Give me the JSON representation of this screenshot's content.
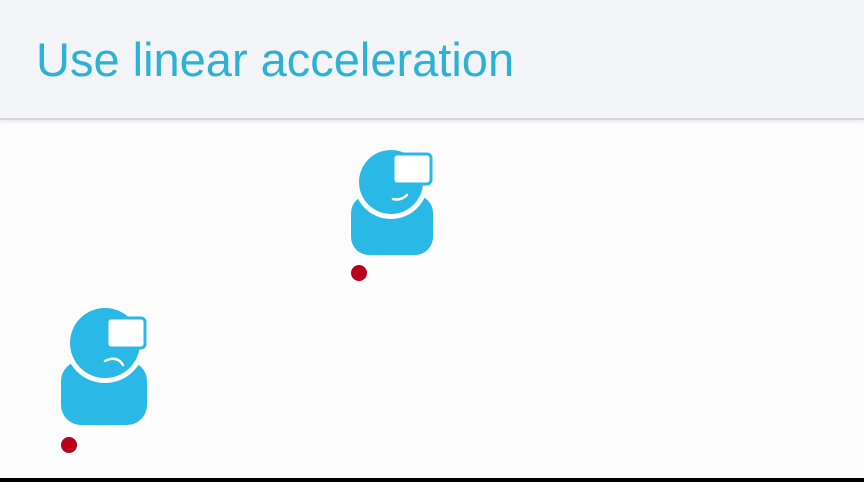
{
  "slide": {
    "title": "Use linear acceleration"
  },
  "colors": {
    "title": "#2bb2d4",
    "figure": "#2ab9e7",
    "headset": "#ffffff",
    "marker": "#b8001c",
    "header_bg": "#f4f5f8",
    "content_bg": "#fdfdfd"
  },
  "icons": {
    "figure": "person-with-vr-headset-icon",
    "marker": "position-dot"
  }
}
